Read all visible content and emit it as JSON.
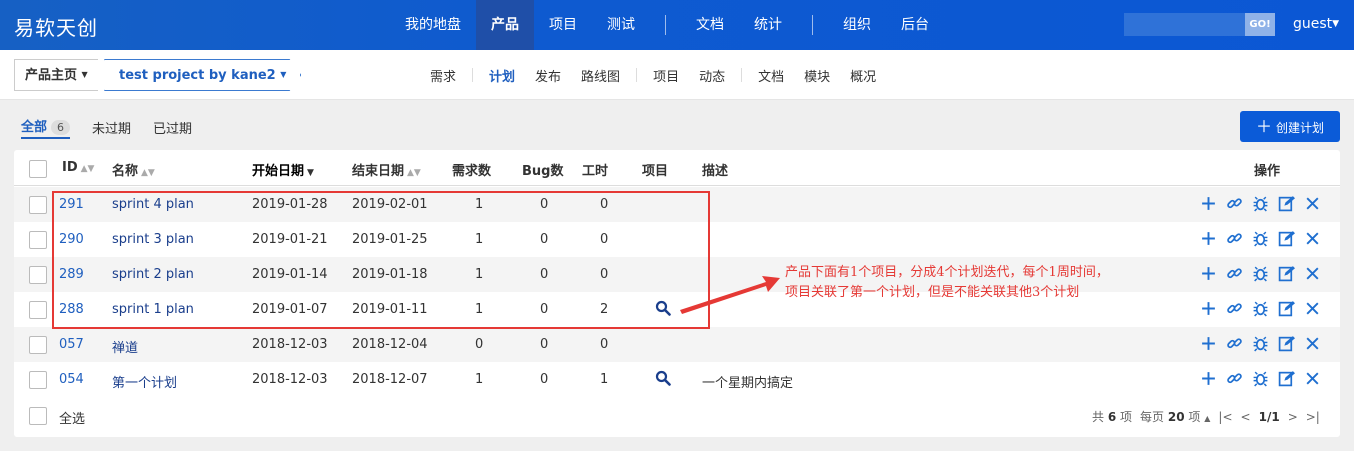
{
  "header": {
    "brand": "易软天创",
    "nav": [
      {
        "label": "我的地盘",
        "active": false
      },
      {
        "label": "产品",
        "active": true
      },
      {
        "label": "项目",
        "active": false
      },
      {
        "label": "测试",
        "active": false
      },
      {
        "label": "文档",
        "active": false
      },
      {
        "label": "统计",
        "active": false
      },
      {
        "label": "组织",
        "active": false
      },
      {
        "label": "后台",
        "active": false
      }
    ],
    "search_button": "GO!",
    "user": "guest"
  },
  "subheader": {
    "crumb_home": "产品主页",
    "crumb_project": "test project by kane2",
    "nav": [
      {
        "label": "需求"
      },
      {
        "label": "计划",
        "active": true
      },
      {
        "label": "发布"
      },
      {
        "label": "路线图"
      },
      {
        "label": "项目"
      },
      {
        "label": "动态"
      },
      {
        "label": "文档"
      },
      {
        "label": "模块"
      },
      {
        "label": "概况"
      }
    ]
  },
  "tabs": {
    "all": "全部",
    "all_count": "6",
    "unexpired": "未过期",
    "expired": "已过期"
  },
  "create_button": "创建计划",
  "table": {
    "headers": {
      "id": "ID",
      "name": "名称",
      "start": "开始日期",
      "end": "结束日期",
      "stories": "需求数",
      "bugs": "Bug数",
      "hours": "工时",
      "project": "项目",
      "desc": "描述",
      "ops": "操作"
    },
    "rows": [
      {
        "id": "291",
        "name": "sprint 4 plan",
        "start": "2019-01-28",
        "end": "2019-02-01",
        "stories": "1",
        "bugs": "0",
        "hours": "0",
        "desc": ""
      },
      {
        "id": "290",
        "name": "sprint 3 plan",
        "start": "2019-01-21",
        "end": "2019-01-25",
        "stories": "1",
        "bugs": "0",
        "hours": "0",
        "desc": ""
      },
      {
        "id": "289",
        "name": "sprint 2 plan",
        "start": "2019-01-14",
        "end": "2019-01-18",
        "stories": "1",
        "bugs": "0",
        "hours": "0",
        "desc": ""
      },
      {
        "id": "288",
        "name": "sprint 1 plan",
        "start": "2019-01-07",
        "end": "2019-01-11",
        "stories": "1",
        "bugs": "0",
        "hours": "2",
        "desc": ""
      },
      {
        "id": "057",
        "name": "禅道",
        "start": "2018-12-03",
        "end": "2018-12-04",
        "stories": "0",
        "bugs": "0",
        "hours": "0",
        "desc": ""
      },
      {
        "id": "054",
        "name": "第一个计划",
        "start": "2018-12-03",
        "end": "2018-12-07",
        "stories": "1",
        "bugs": "0",
        "hours": "1",
        "desc": "一个星期内搞定"
      }
    ],
    "select_all": "全选",
    "total_prefix": "共",
    "total": "6",
    "total_suffix": "项",
    "per_page_prefix": "每页",
    "per_page": "20",
    "per_page_suffix": "项",
    "page": "1/1"
  },
  "annotation": {
    "line1": "产品下面有1个项目，分成4个计划迭代，每个1周时间，",
    "line2": "项目关联了第一个计划，但是不能关联其他3个计划"
  }
}
